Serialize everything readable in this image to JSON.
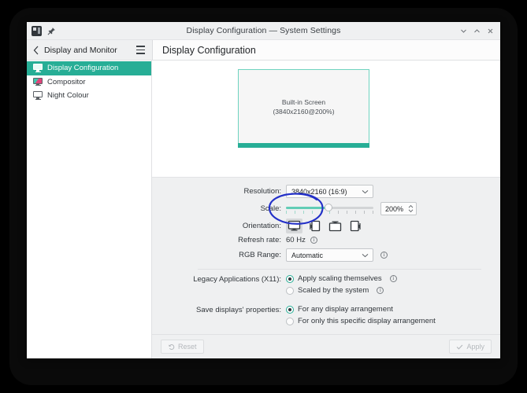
{
  "window": {
    "title": "Display Configuration — System Settings",
    "app_icon": "system-settings-icon",
    "pin_icon": "pin-icon",
    "minimize_icon": "chevron-down-icon",
    "maximize_icon": "chevron-up-icon",
    "close_icon": "close-icon"
  },
  "header": {
    "back_label": "Display and Monitor",
    "back_icon": "chevron-left-icon",
    "menu_icon": "hamburger-menu-icon",
    "page_title": "Display Configuration"
  },
  "sidebar": {
    "items": [
      {
        "label": "Display Configuration",
        "icon": "monitor-icon",
        "active": true
      },
      {
        "label": "Compositor",
        "icon": "monitor-colored-icon",
        "active": false
      },
      {
        "label": "Night Colour",
        "icon": "monitor-icon",
        "active": false
      }
    ]
  },
  "preview": {
    "screen_name": "Built-in Screen",
    "screen_spec": "(3840x2160@200%)"
  },
  "settings": {
    "resolution": {
      "label": "Resolution:",
      "value": "3840x2160 (16:9)"
    },
    "scale": {
      "label": "Scale:",
      "value": "200%",
      "slider_percent": 48,
      "tick_count": 11
    },
    "orientation": {
      "label": "Orientation:",
      "options": [
        "landscape-icon",
        "portrait-icon",
        "landscape-flipped-icon",
        "portrait-flipped-icon"
      ],
      "selected_index": 0
    },
    "refresh_rate": {
      "label": "Refresh rate:",
      "value": "60 Hz",
      "info_icon": "info-icon"
    },
    "rgb_range": {
      "label": "RGB Range:",
      "value": "Automatic",
      "info_icon": "info-icon"
    },
    "legacy_applications": {
      "label": "Legacy Applications (X11):",
      "options": [
        {
          "text": "Apply scaling themselves",
          "selected": true,
          "info_icon": "info-icon"
        },
        {
          "text": "Scaled by the system",
          "selected": false,
          "info_icon": "info-icon"
        }
      ]
    },
    "save_displays": {
      "label": "Save displays' properties:",
      "options": [
        {
          "text": "For any display arrangement",
          "selected": true
        },
        {
          "text": "For only this specific display arrangement",
          "selected": false
        }
      ]
    }
  },
  "footer": {
    "reset_label": "Reset",
    "reset_icon": "undo-icon",
    "apply_label": "Apply",
    "apply_icon": "check-icon"
  },
  "annotation": {
    "shape": "hand-drawn-ellipse",
    "color": "#2330c8",
    "targets": "scale-value-spinbox"
  },
  "colors": {
    "accent": "#27ae96",
    "panel": "#eff0f1",
    "window": "#fcfcfc",
    "text": "#31363b",
    "annotation": "#2330c8"
  }
}
